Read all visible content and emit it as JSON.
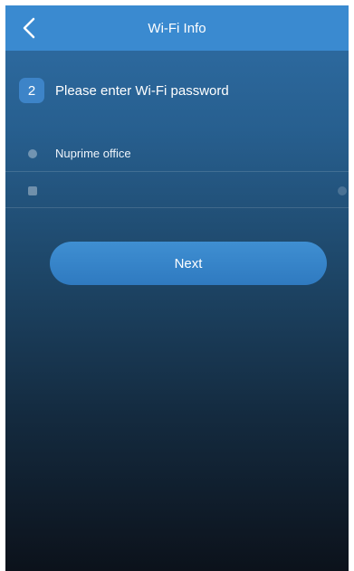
{
  "header": {
    "title": "Wi-Fi Info",
    "back_icon": "chevron-left-icon",
    "background": "#3a8ad0"
  },
  "step": {
    "number": "2",
    "instruction": "Please enter Wi-Fi password"
  },
  "form": {
    "ssid_icon": "wifi-icon",
    "ssid_value": "Nuprime office",
    "password_icon": "lock-icon",
    "password_value": "",
    "password_placeholder": ""
  },
  "actions": {
    "next_label": "Next"
  },
  "colors": {
    "accent": "#3a8ad0",
    "background_top": "#2f6ea6",
    "background_bottom": "#0c121b"
  }
}
